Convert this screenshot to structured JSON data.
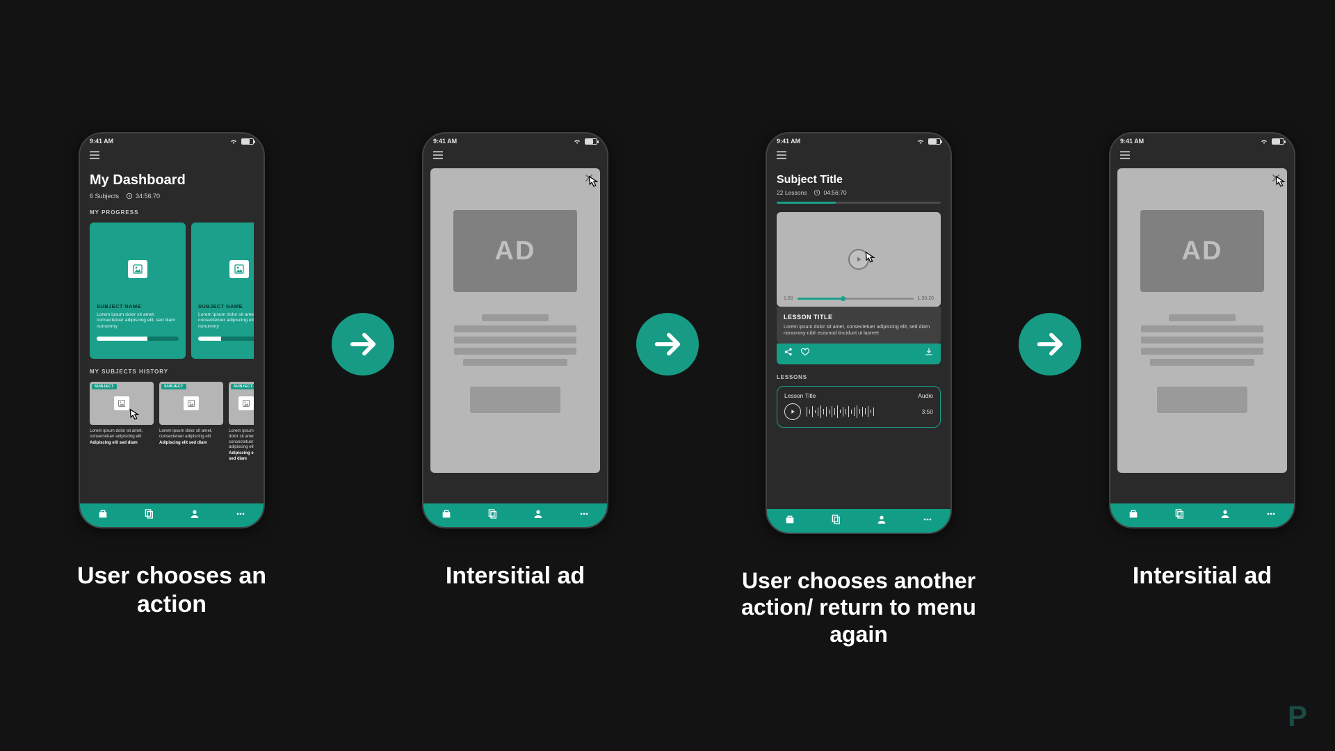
{
  "captions": {
    "step1": "User chooses an action",
    "step2": "Intersitial ad",
    "step3": "User chooses another action/ return to menu again",
    "step4": "Intersitial ad"
  },
  "status": {
    "time": "9:41 AM"
  },
  "dashboard": {
    "title": "My Dashboard",
    "subjects_count": "6 Subjects",
    "time_stat": "34:56:70",
    "progress_label": "MY PROGRESS",
    "history_label": "MY SUBJECTS HISTORY",
    "cards": [
      {
        "name": "SUBJECT NAME",
        "desc": "Lorem ipsum dolor sit amet, consectetuer adipiscing elit, sed diam nonummy"
      },
      {
        "name": "SUBJECT NAME",
        "desc": "Lorem ipsum dolor sit amet, consectetuer adipiscing elit, sed diam nonummy"
      }
    ],
    "history_tag": "SUBJECT",
    "history_desc": "Lorem ipsum dolor sit amet, consectetuer adipiscing elit",
    "history_bold": "Adipiscing elit sed diam"
  },
  "ad": {
    "label": "AD"
  },
  "subject": {
    "title": "Subject Title",
    "lessons_count": "22 Lessons",
    "time_stat": "04:56:70",
    "video": {
      "start": "1:00",
      "end": "1:30:20"
    },
    "lesson_title": "LESSON TITLE",
    "lesson_desc": "Lorem ipsum dolor sit amet, consectetuer adipiscing elit, sed diam nonummy nibh euismod tincidunt ut laoreet",
    "lessons_label": "LESSONS",
    "item": {
      "title": "Lesson Title",
      "type": "Audio",
      "duration": "3:50"
    }
  },
  "logo": "P"
}
